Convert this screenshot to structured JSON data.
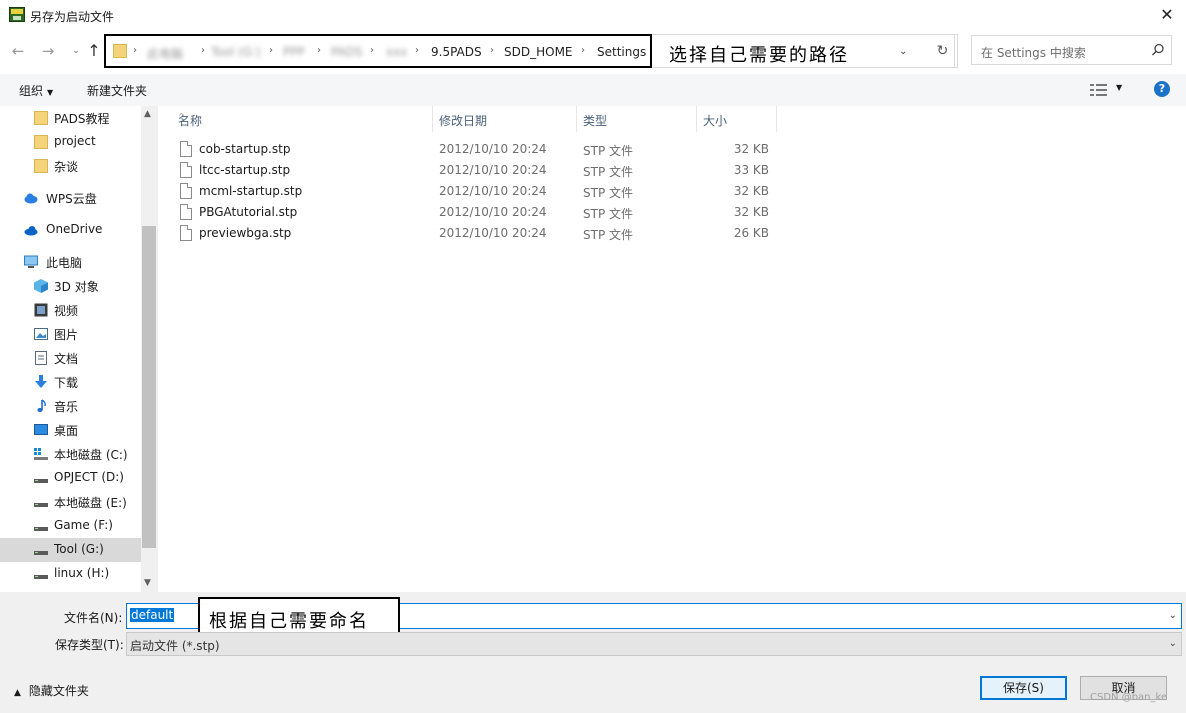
{
  "window": {
    "title": "另存为启动文件",
    "close_glyph": "✕"
  },
  "address": {
    "blurred_crumbs": [
      "此电脑",
      "Tool (G:)",
      "PPP",
      "PADS",
      "xxx"
    ],
    "crumbs": [
      "9.5PADS",
      "SDD_HOME",
      "Settings"
    ],
    "annotation": "选择自己需要的路径",
    "search_placeholder": "在 Settings 中搜索"
  },
  "toolbar": {
    "organize_label": "组织",
    "new_folder_label": "新建文件夹",
    "help_label": "?"
  },
  "sidebar": {
    "items": [
      {
        "label": "PADS教程",
        "icon": "folder-icon"
      },
      {
        "label": "project",
        "icon": "folder-icon"
      },
      {
        "label": "杂谈",
        "icon": "folder-icon"
      },
      {
        "label": "WPS云盘",
        "icon": "cloud-icon"
      },
      {
        "label": "OneDrive",
        "icon": "onedrive-icon"
      },
      {
        "label": "此电脑",
        "icon": "computer-icon"
      },
      {
        "label": "3D 对象",
        "icon": "cube-icon"
      },
      {
        "label": "视频",
        "icon": "video-icon"
      },
      {
        "label": "图片",
        "icon": "picture-icon"
      },
      {
        "label": "文档",
        "icon": "document-icon"
      },
      {
        "label": "下载",
        "icon": "download-icon"
      },
      {
        "label": "音乐",
        "icon": "music-icon"
      },
      {
        "label": "桌面",
        "icon": "desktop-icon"
      },
      {
        "label": "本地磁盘 (C:)",
        "icon": "windows-drive-icon"
      },
      {
        "label": "OPJECT (D:)",
        "icon": "drive-icon"
      },
      {
        "label": "本地磁盘 (E:)",
        "icon": "drive-icon"
      },
      {
        "label": "Game (F:)",
        "icon": "drive-icon"
      },
      {
        "label": "Tool (G:)",
        "icon": "drive-icon",
        "selected": true
      },
      {
        "label": "linux (H:)",
        "icon": "drive-icon"
      }
    ]
  },
  "filelist": {
    "columns": [
      "名称",
      "修改日期",
      "类型",
      "大小"
    ],
    "files": [
      {
        "name": "cob-startup.stp",
        "date": "2012/10/10 20:24",
        "type": "STP 文件",
        "size": "32 KB"
      },
      {
        "name": "ltcc-startup.stp",
        "date": "2012/10/10 20:24",
        "type": "STP 文件",
        "size": "33 KB"
      },
      {
        "name": "mcml-startup.stp",
        "date": "2012/10/10 20:24",
        "type": "STP 文件",
        "size": "32 KB"
      },
      {
        "name": "PBGAtutorial.stp",
        "date": "2012/10/10 20:24",
        "type": "STP 文件",
        "size": "32 KB"
      },
      {
        "name": "previewbga.stp",
        "date": "2012/10/10 20:24",
        "type": "STP 文件",
        "size": "26 KB"
      }
    ]
  },
  "form": {
    "filename_label": "文件名(N):",
    "filename_value": "default",
    "filename_annotation": "根据自己需要命名",
    "filetype_label": "保存类型(T):",
    "filetype_value": "启动文件 (*.stp)",
    "hide_folders_label": "隐藏文件夹",
    "save_label": "保存(S)",
    "cancel_label": "取消",
    "watermark": "CSDN @ban_ke"
  },
  "colors": {
    "accent": "#0078d7",
    "selection": "#d9d9d9",
    "column_header": "#4c607a"
  }
}
